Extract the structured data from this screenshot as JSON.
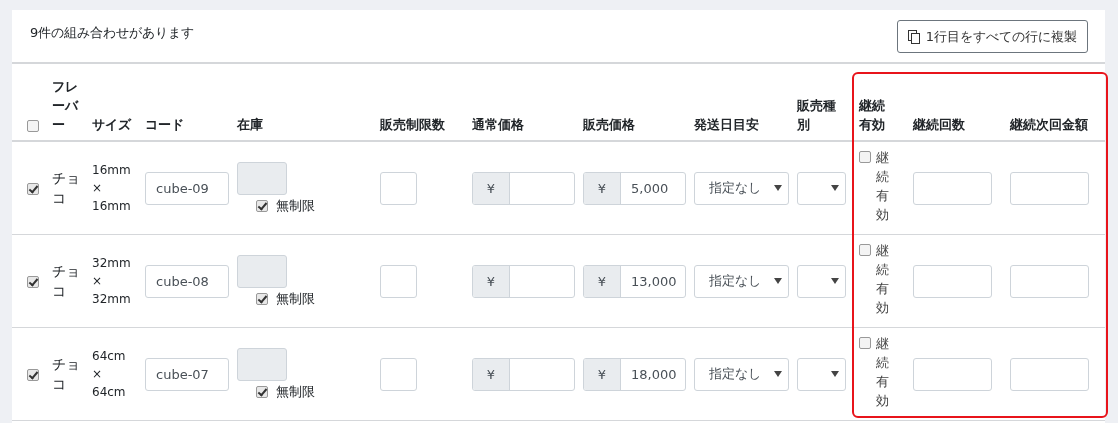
{
  "summary": "9件の組み合わせがあります",
  "copy_button": "1行目をすべての行に複製",
  "table": {
    "select_all": {
      "checked": false
    },
    "columns": [
      "フレーバー",
      "サイズ",
      "コード",
      "在庫",
      "販売制限数",
      "通常価格",
      "販売価格",
      "発送日目安",
      "販売種別",
      "継続有効",
      "継続回数",
      "継続次回金額"
    ],
    "rows": [
      {
        "selected": true,
        "flavor": "チョコ",
        "size": "16mm × 16mm",
        "code": "cube-09",
        "stock_unlimited": true,
        "unlimited_label": "無制限",
        "normal_yen": "¥",
        "sale_yen": "¥",
        "sale_price": "5,000",
        "shipping": "指定なし",
        "continue_enabled": false,
        "continue_label": "継続有効"
      },
      {
        "selected": true,
        "flavor": "チョコ",
        "size": "32mm × 32mm",
        "code": "cube-08",
        "stock_unlimited": true,
        "unlimited_label": "無制限",
        "normal_yen": "¥",
        "sale_yen": "¥",
        "sale_price": "13,000",
        "shipping": "指定なし",
        "continue_enabled": false,
        "continue_label": "継続有効"
      },
      {
        "selected": true,
        "flavor": "チョコ",
        "size": "64cm × 64cm",
        "code": "cube-07",
        "stock_unlimited": true,
        "unlimited_label": "無制限",
        "normal_yen": "¥",
        "sale_yen": "¥",
        "sale_price": "18,000",
        "shipping": "指定なし",
        "continue_enabled": false,
        "continue_label": "継続有効"
      }
    ]
  }
}
